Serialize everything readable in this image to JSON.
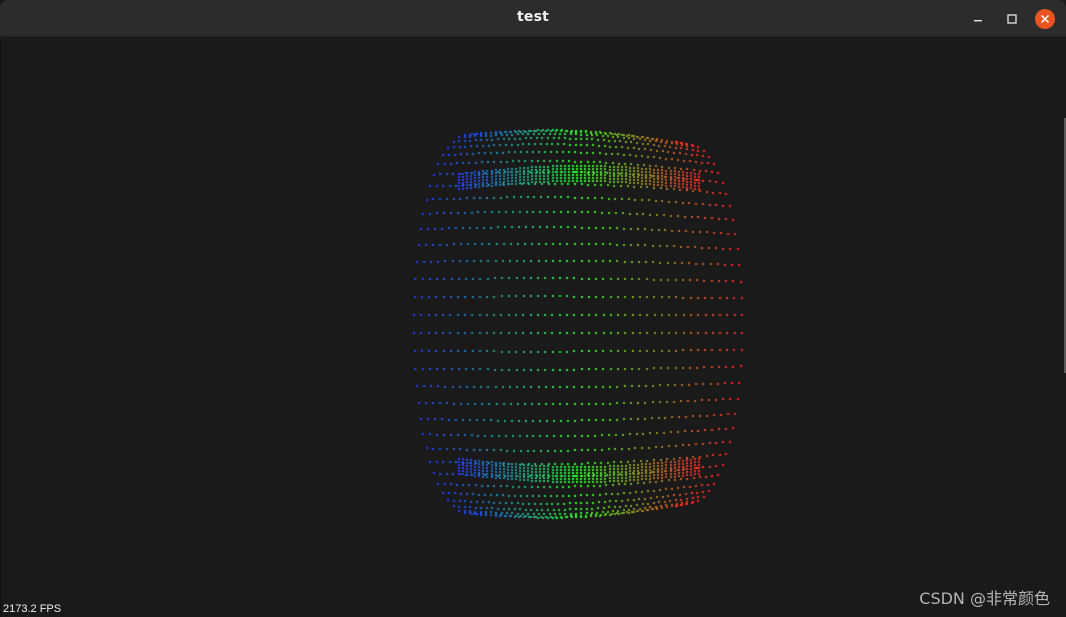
{
  "window": {
    "title": "test"
  },
  "viewer": {
    "fps_text": "2173.2 FPS",
    "watermark": "CSDN @非常颜色",
    "colors": {
      "background": "#1a1a1a",
      "point_far": "#1e3cff",
      "point_mid": "#28ff28",
      "point_near": "#ff2020"
    }
  }
}
